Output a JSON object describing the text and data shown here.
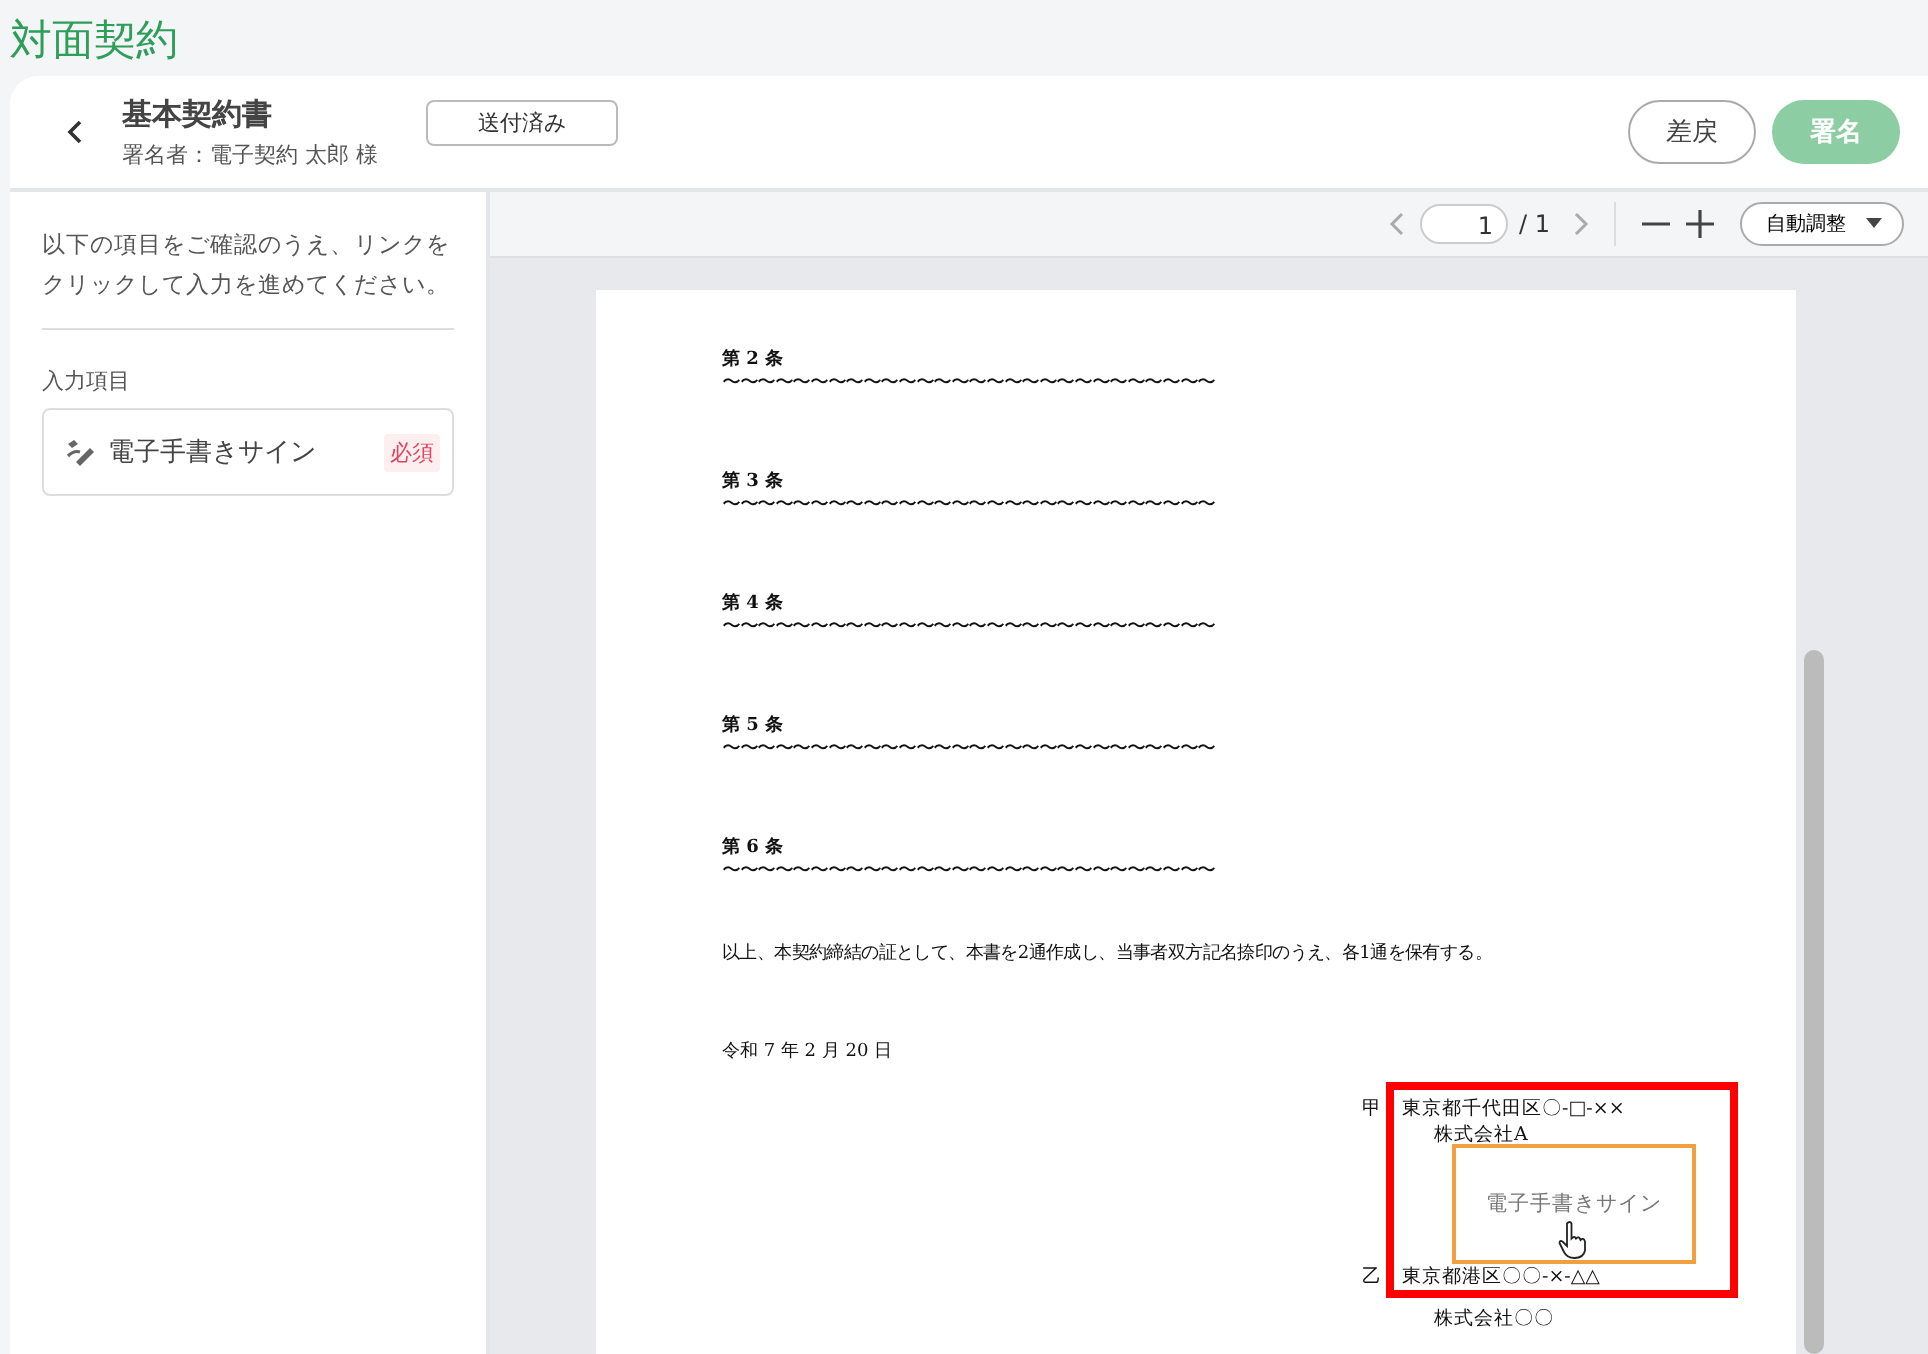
{
  "app_title": "対面契約",
  "header": {
    "document_title": "基本契約書",
    "signer": "署名者：電子契約 太郎 様",
    "status": "送付済み",
    "buttons": [
      {
        "label": "差戻",
        "kind": "outline",
        "disabled": false
      },
      {
        "label": "署名",
        "kind": "primary",
        "disabled": true
      }
    ]
  },
  "sidebar": {
    "instructions": "以下の項目をご確認のうえ、リンクをクリックして入力を進めてください。",
    "section_label": "入力項目",
    "items": [
      {
        "label": "電子手書きサイン",
        "badge": "必須"
      }
    ]
  },
  "toolbar": {
    "page": "1",
    "total": "/ 1",
    "zoom": "自動調整"
  },
  "document": {
    "articles": [
      {
        "heading": "第 2 条",
        "body": "〜〜〜〜〜〜〜〜〜〜〜〜〜〜〜〜〜〜〜〜〜〜〜〜〜〜〜〜"
      },
      {
        "heading": "第 3 条",
        "body": "〜〜〜〜〜〜〜〜〜〜〜〜〜〜〜〜〜〜〜〜〜〜〜〜〜〜〜〜"
      },
      {
        "heading": "第 4 条",
        "body": "〜〜〜〜〜〜〜〜〜〜〜〜〜〜〜〜〜〜〜〜〜〜〜〜〜〜〜〜"
      },
      {
        "heading": "第 5 条",
        "body": "〜〜〜〜〜〜〜〜〜〜〜〜〜〜〜〜〜〜〜〜〜〜〜〜〜〜〜〜"
      },
      {
        "heading": "第 6 条",
        "body": "〜〜〜〜〜〜〜〜〜〜〜〜〜〜〜〜〜〜〜〜〜〜〜〜〜〜〜〜"
      }
    ],
    "closing": "以上、本契約締結の証として、本書を2通作成し、当事者双方記名捺印のうえ、各1通を保有する。",
    "date": "令和 7 年 2 月 20 日",
    "parties": [
      {
        "mark": "甲",
        "address": "東京都千代田区〇-□-××",
        "company": "株式会社A"
      },
      {
        "mark": "乙",
        "address": "東京都港区〇〇-×-△△",
        "company": "株式会社〇〇"
      }
    ],
    "signature_field": "電子手書きサイン"
  }
}
